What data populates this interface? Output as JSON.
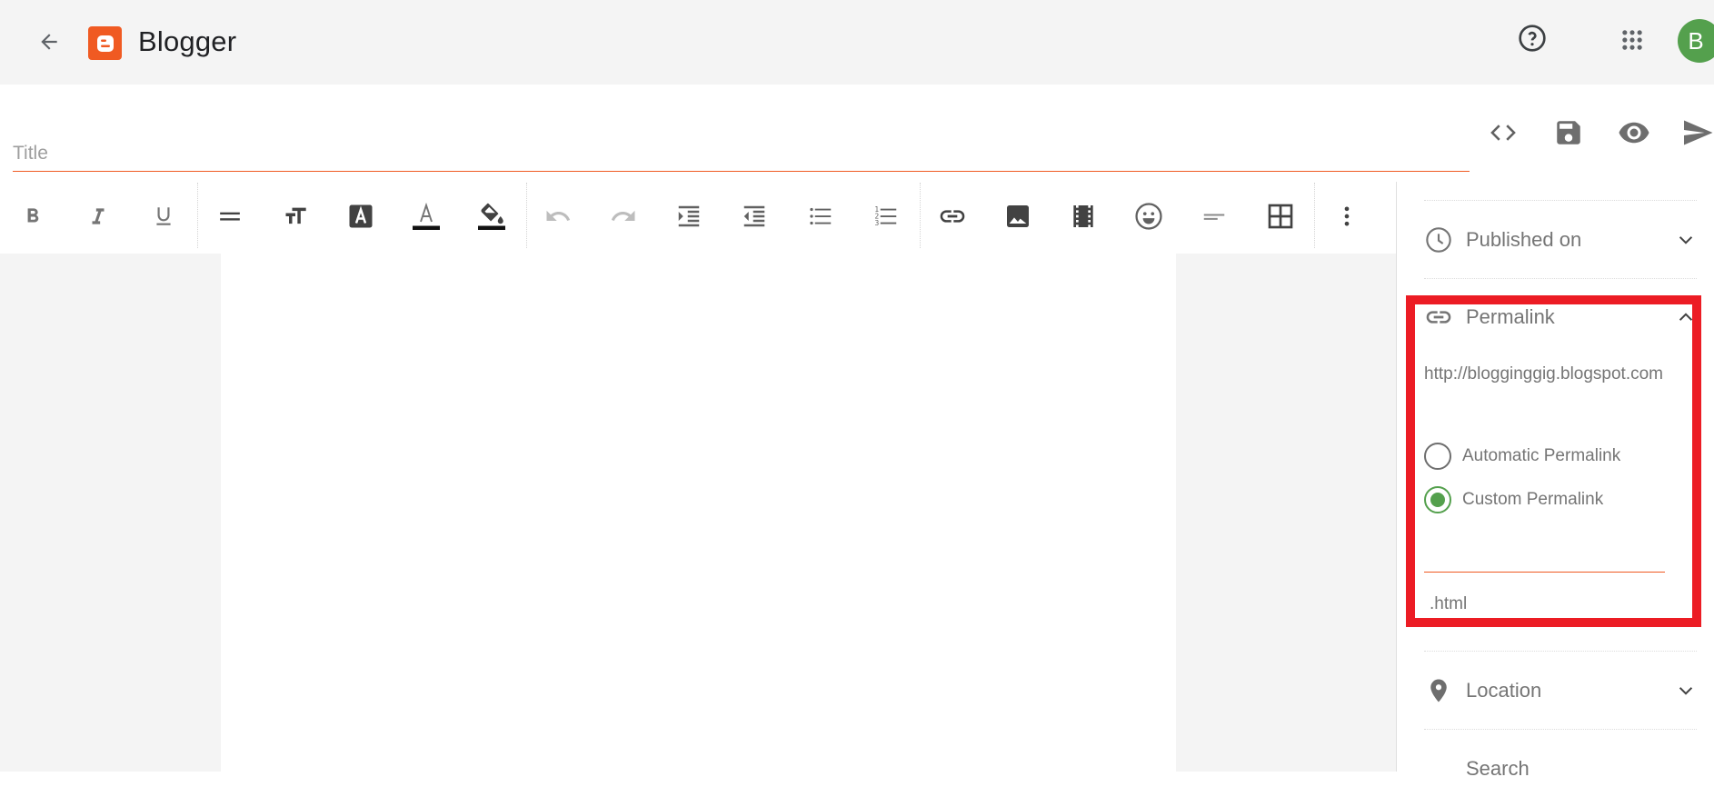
{
  "header": {
    "brand": "Blogger",
    "avatar_letter": "B",
    "icons": {
      "back": "arrow-back-icon",
      "logo": "blogger-logo-icon",
      "help": "help-circle-icon",
      "apps": "apps-grid-icon"
    }
  },
  "post": {
    "title_placeholder": "Title",
    "title_value": ""
  },
  "actions": [
    {
      "name": "html-view",
      "icon": "code-icon"
    },
    {
      "name": "save",
      "icon": "save-icon"
    },
    {
      "name": "preview",
      "icon": "eye-icon"
    },
    {
      "name": "publish",
      "icon": "send-icon"
    }
  ],
  "toolbar": [
    {
      "name": "bold",
      "icon": "bold-icon",
      "label": "B"
    },
    {
      "name": "italic",
      "icon": "italic-icon",
      "label": "I"
    },
    {
      "name": "underline",
      "icon": "underline-icon",
      "label": "U"
    },
    {
      "name": "paragraph",
      "icon": "paragraph-icon"
    },
    {
      "name": "font-size",
      "icon": "font-size-icon"
    },
    {
      "name": "text-style",
      "icon": "font-style-icon",
      "label": "A"
    },
    {
      "name": "text-color",
      "icon": "text-color-icon",
      "label": "A"
    },
    {
      "name": "highlight-color",
      "icon": "fill-color-icon"
    },
    {
      "name": "undo",
      "icon": "undo-icon",
      "disabled": true
    },
    {
      "name": "redo",
      "icon": "redo-icon",
      "disabled": true
    },
    {
      "name": "indent",
      "icon": "indent-icon"
    },
    {
      "name": "outdent",
      "icon": "outdent-icon"
    },
    {
      "name": "bulleted-list",
      "icon": "bulleted-list-icon"
    },
    {
      "name": "numbered-list",
      "icon": "numbered-list-icon"
    },
    {
      "name": "insert-link",
      "icon": "link-icon"
    },
    {
      "name": "insert-image",
      "icon": "image-icon"
    },
    {
      "name": "insert-video",
      "icon": "video-icon"
    },
    {
      "name": "insert-emoji",
      "icon": "emoji-icon"
    },
    {
      "name": "alignment",
      "icon": "align-left-icon"
    },
    {
      "name": "insert-table",
      "icon": "table-icon"
    },
    {
      "name": "more-options",
      "icon": "more-vert-icon"
    }
  ],
  "sidebar": {
    "published_on": {
      "label": "Published on",
      "icon": "clock-icon",
      "expanded": false
    },
    "permalink": {
      "label": "Permalink",
      "icon": "link-icon",
      "expanded": true,
      "url": "http://blogginggig.blogspot.com",
      "options": [
        {
          "label": "Automatic Permalink",
          "checked": false
        },
        {
          "label": "Custom Permalink",
          "checked": true
        }
      ],
      "custom_value": "",
      "suffix": ".html"
    },
    "location": {
      "label": "Location",
      "icon": "location-pin-icon",
      "expanded": false
    },
    "search": {
      "label": "Search",
      "icon": "search-description-icon"
    }
  },
  "colors": {
    "brand_orange": "#f05a22",
    "accent_green": "#54a04d",
    "highlight_red": "#ec1c24",
    "icon_gray": "#757575"
  }
}
